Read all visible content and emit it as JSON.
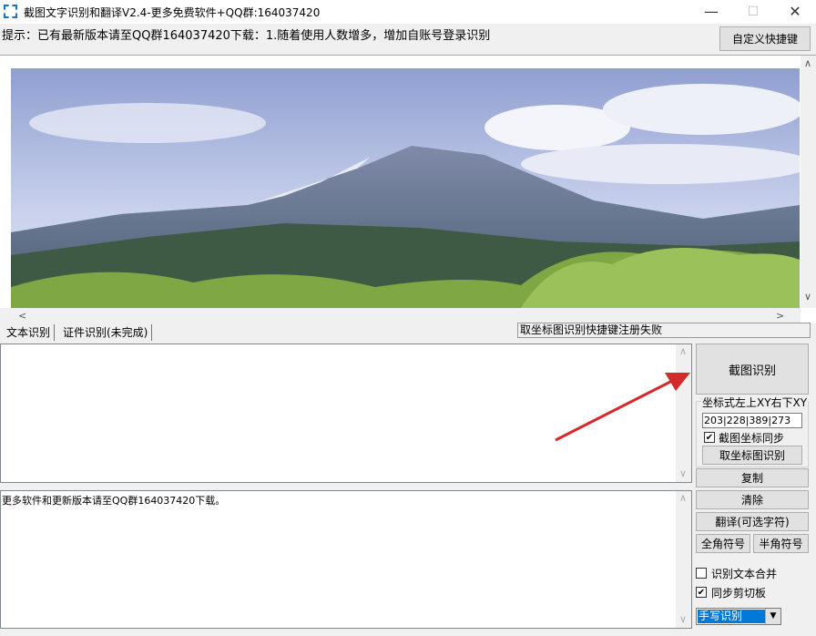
{
  "window": {
    "title": "截图文字识别和翻译V2.4-更多免费软件+QQ群:164037420",
    "minimize_glyph": "—",
    "maximize_glyph": "☐",
    "close_glyph": "✕"
  },
  "hint": "提示：已有最新版本请至QQ群164037420下载：1.随着使用人数增多，增加自账号登录识别",
  "shortcut_button": "自定义快捷键",
  "tabs": [
    {
      "label": "文本识别"
    },
    {
      "label": "证件识别(未完成)"
    }
  ],
  "status_message": "取坐标图识别快捷键注册失败",
  "output_text": "更多软件和更新版本请至QQ群164037420下载。",
  "right_panel": {
    "capture_button": "截图识别",
    "coord_group_label": "坐标式左上XY右下XY",
    "coord_value": "203|228|389|273",
    "sync_checkbox": {
      "label": "截图坐标同步",
      "checked": true
    },
    "coord_capture_button": "取坐标图识别",
    "copy_button": "复制",
    "clear_button": "清除",
    "translate_button": "翻译(可选字符)",
    "fullwidth_button": "全角符号",
    "halfwidth_button": "半角符号",
    "merge_checkbox": {
      "label": "识别文本合并",
      "checked": false
    },
    "clipboard_checkbox": {
      "label": "同步剪切板",
      "checked": true
    },
    "mode_select": {
      "value": "手写识别"
    }
  },
  "colors": {
    "accent": "#0078d7",
    "arrow": "#d42a2a",
    "sky": "#b9c7e4",
    "mountain": "#5d6f86"
  },
  "icons": {
    "app": "dashed-selection-icon",
    "check": "✔",
    "scroll_up": "∧",
    "scroll_down": "∨",
    "scroll_left": "<",
    "scroll_right": ">",
    "dropdown": "▼"
  }
}
